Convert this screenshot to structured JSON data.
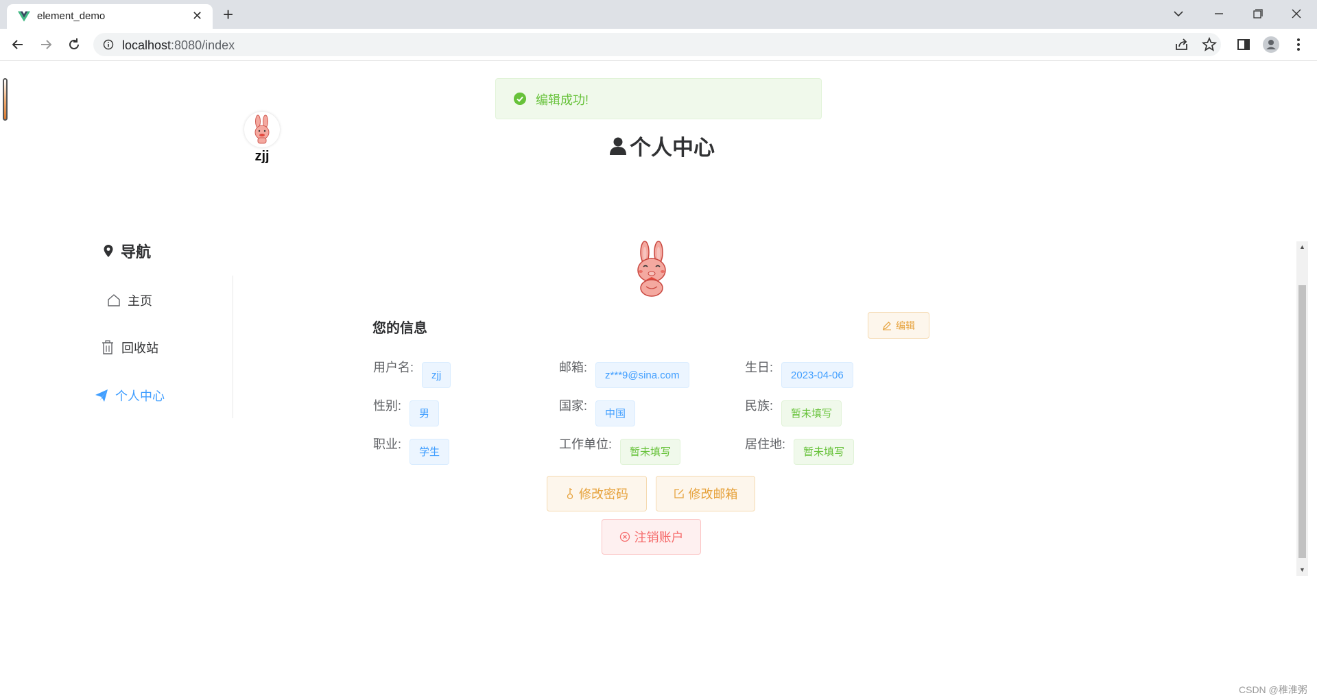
{
  "browser": {
    "tab_title": "element_demo",
    "tab_close": "✕",
    "new_tab": "+",
    "url_host": "localhost",
    "url_rest": ":8080/index"
  },
  "toast": {
    "message": "编辑成功!"
  },
  "user": {
    "name": "zjj"
  },
  "page": {
    "title": "个人中心"
  },
  "nav": {
    "heading": "导航",
    "items": [
      {
        "label": "主页",
        "icon": "home-icon"
      },
      {
        "label": "回收站",
        "icon": "trash-icon"
      },
      {
        "label": "个人中心",
        "icon": "paper-plane-icon",
        "active": true
      }
    ]
  },
  "info": {
    "heading": "您的信息",
    "edit_label": "编辑",
    "fields": {
      "username": {
        "label": "用户名:",
        "value": "zjj"
      },
      "email": {
        "label": "邮箱:",
        "value": "z***9@sina.com"
      },
      "birthday": {
        "label": "生日:",
        "value": "2023-04-06"
      },
      "gender": {
        "label": "性别:",
        "value": "男"
      },
      "country": {
        "label": "国家:",
        "value": "中国"
      },
      "ethnicity": {
        "label": "民族:",
        "value": "暂未填写"
      },
      "job": {
        "label": "职业:",
        "value": "学生"
      },
      "company": {
        "label": "工作单位:",
        "value": "暂未填写"
      },
      "residence": {
        "label": "居住地:",
        "value": "暂未填写"
      }
    }
  },
  "actions": {
    "change_password": "修改密码",
    "change_email": "修改邮箱",
    "delete_account": "注销账户"
  },
  "watermark": "CSDN @稚淮粥",
  "colors": {
    "primary": "#409eff",
    "success": "#67c23a",
    "warning": "#e6a23c",
    "danger": "#f56c6c"
  }
}
